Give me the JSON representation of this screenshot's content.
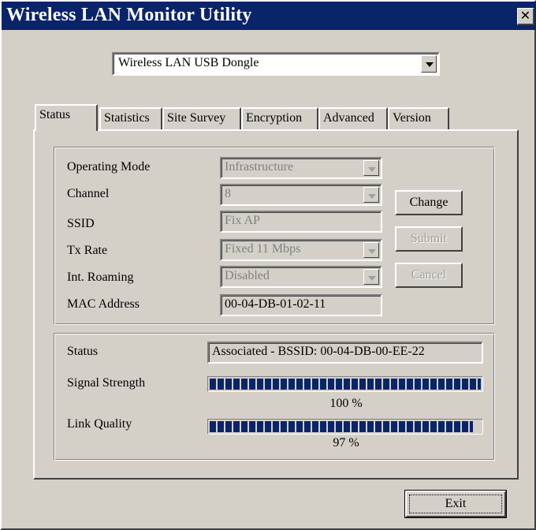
{
  "window": {
    "title": "Wireless LAN Monitor Utility"
  },
  "device": {
    "selected": "Wireless LAN USB Dongle"
  },
  "tabs": [
    {
      "label": "Status"
    },
    {
      "label": "Statistics"
    },
    {
      "label": "Site Survey"
    },
    {
      "label": "Encryption"
    },
    {
      "label": "Advanced"
    },
    {
      "label": "Version"
    }
  ],
  "config": {
    "operating_mode": {
      "label": "Operating Mode",
      "value": "Infrastructure"
    },
    "channel": {
      "label": "Channel",
      "value": "8"
    },
    "ssid": {
      "label": "SSID",
      "value": "Fix AP"
    },
    "tx_rate": {
      "label": "Tx Rate",
      "value": "Fixed 11 Mbps"
    },
    "int_roaming": {
      "label": "Int. Roaming",
      "value": "Disabled"
    },
    "mac_address": {
      "label": "MAC Address",
      "value": "00-04-DB-01-02-11"
    }
  },
  "buttons": {
    "change": "Change",
    "submit": "Submit",
    "cancel": "Cancel",
    "exit": "Exit"
  },
  "status": {
    "status_label": "Status",
    "status_value": "Associated - BSSID: 00-04-DB-00-EE-22",
    "signal_label": "Signal Strength",
    "signal_text": "100 %",
    "signal_percent": 100,
    "link_label": "Link Quality",
    "link_text": "97 %",
    "link_percent": 97
  },
  "icons": {
    "close": "close-icon",
    "dropdown": "chevron-down-icon"
  }
}
